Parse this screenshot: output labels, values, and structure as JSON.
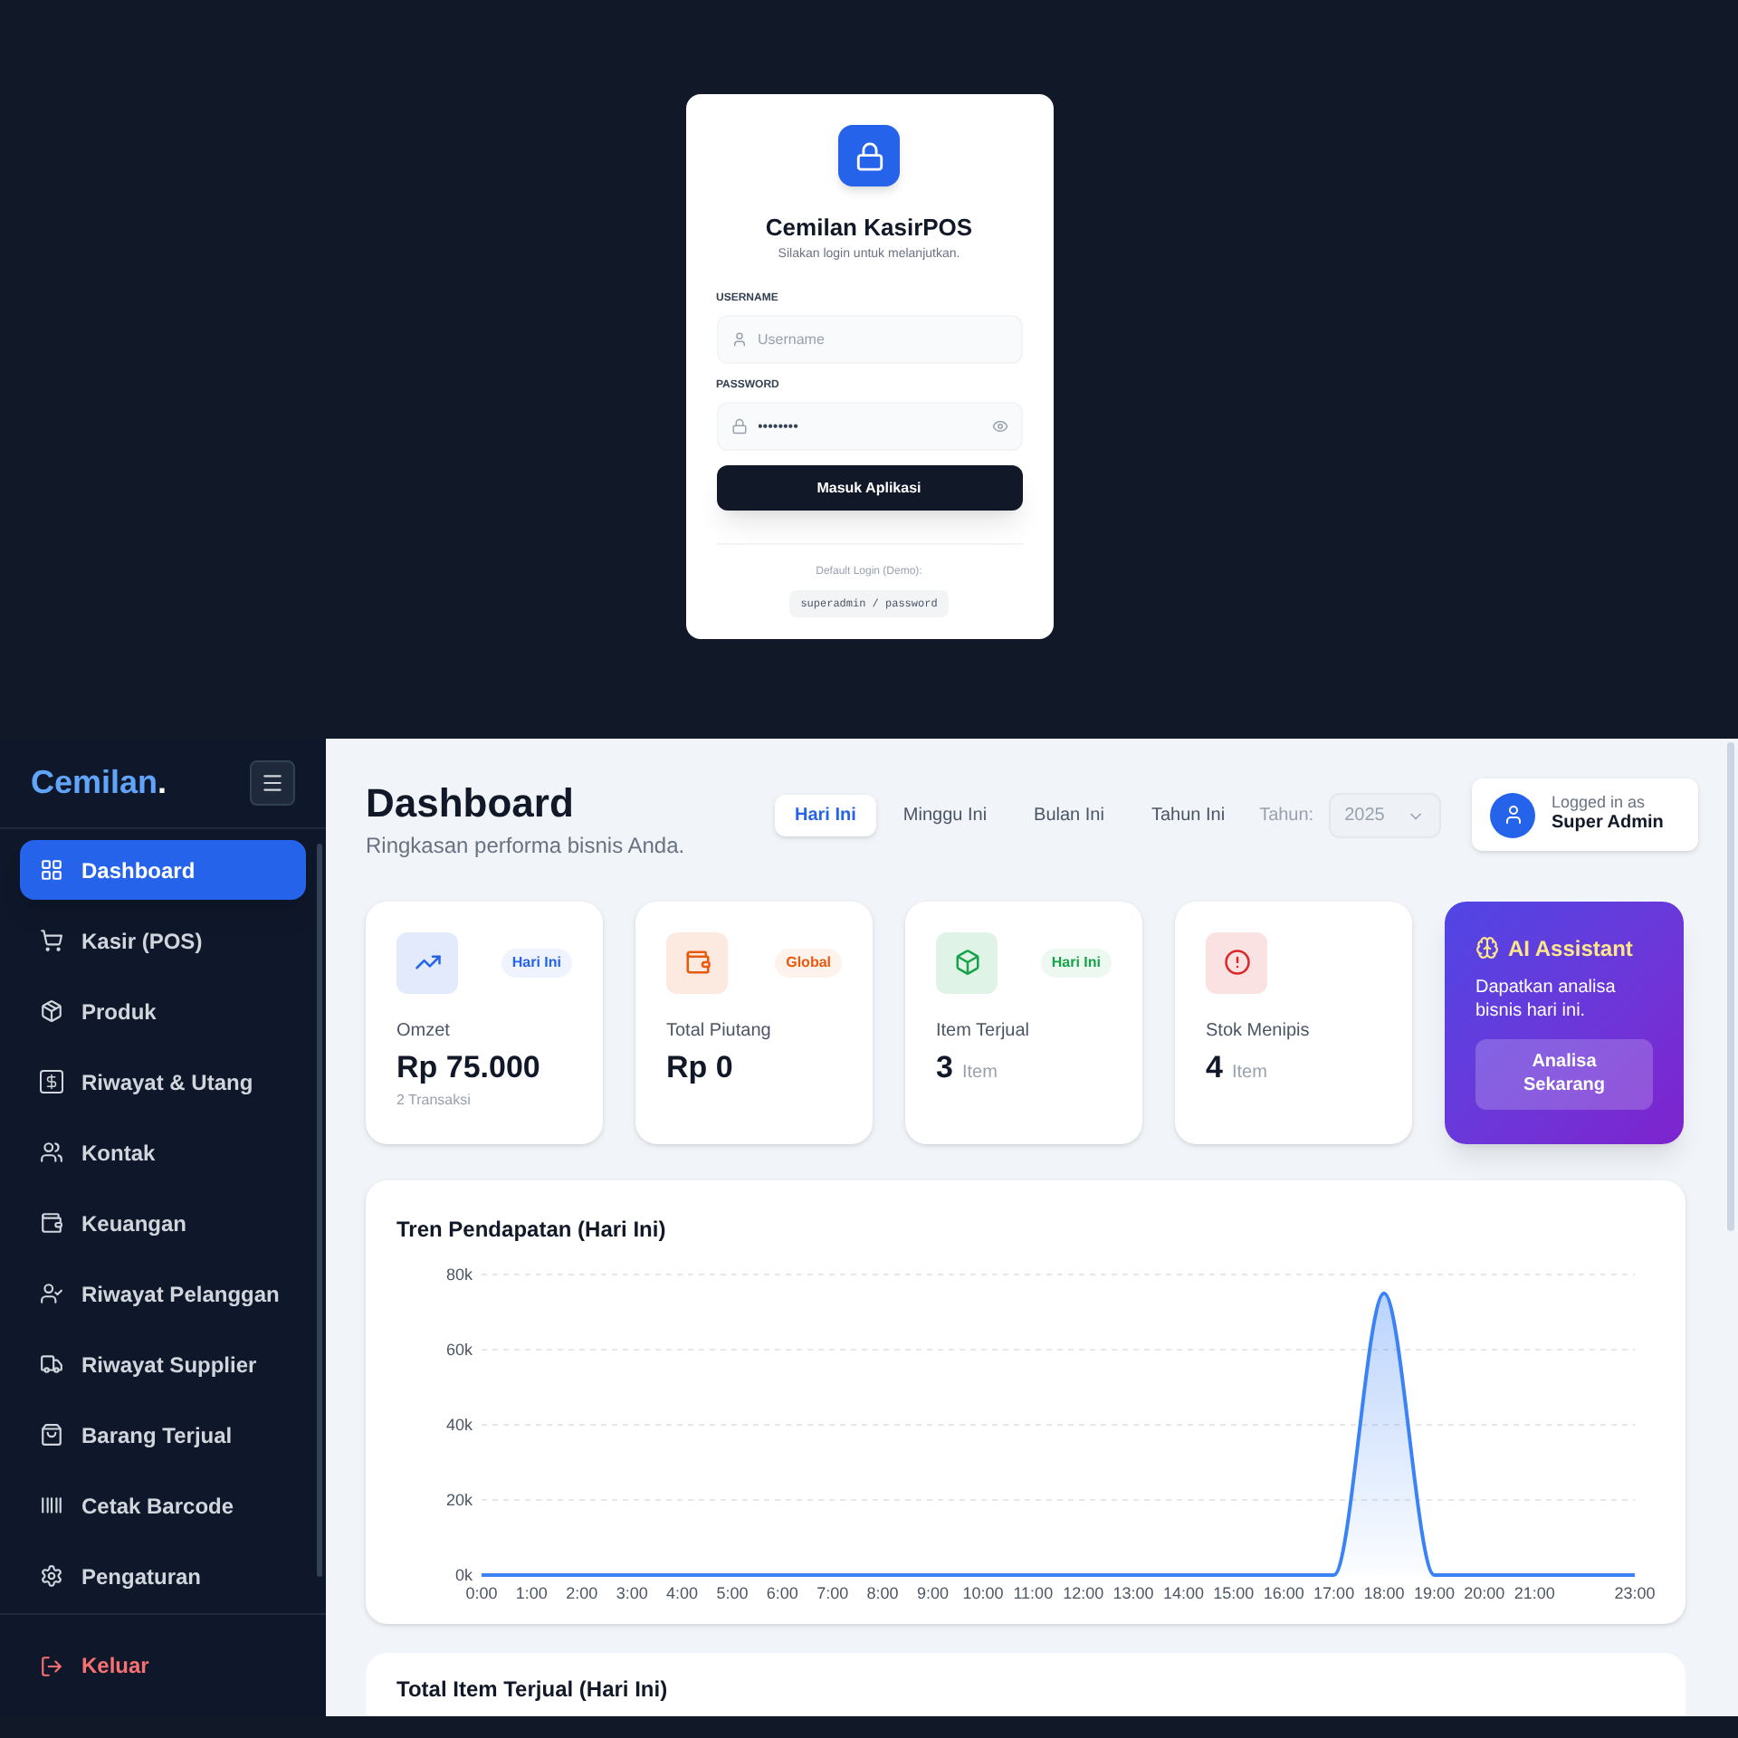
{
  "login": {
    "title": "Cemilan KasirPOS",
    "subtitle": "Silakan login untuk melanjutkan.",
    "fields": [
      {
        "label": "USERNAME",
        "placeholder": "Username",
        "kind": "text"
      },
      {
        "label": "PASSWORD",
        "value": "••••••••",
        "kind": "password"
      }
    ],
    "submit": "Masuk Aplikasi",
    "demo_label": "Default Login (Demo):",
    "demo_credentials": "superadmin / password"
  },
  "sidebar": {
    "brand": "Cemilan",
    "brand_dot": ".",
    "items": [
      {
        "label": "Dashboard",
        "selected": true
      },
      {
        "label": "Kasir (POS)",
        "selected": false
      },
      {
        "label": "Produk",
        "selected": false
      },
      {
        "label": "Riwayat & Utang",
        "selected": false
      },
      {
        "label": "Kontak",
        "selected": false
      },
      {
        "label": "Keuangan",
        "selected": false
      },
      {
        "label": "Riwayat Pelanggan",
        "selected": false
      },
      {
        "label": "Riwayat Supplier",
        "selected": false
      },
      {
        "label": "Barang Terjual",
        "selected": false
      },
      {
        "label": "Cetak Barcode",
        "selected": false
      },
      {
        "label": "Pengaturan",
        "selected": false
      }
    ],
    "logout": "Keluar"
  },
  "header": {
    "title": "Dashboard",
    "subtitle": "Ringkasan performa bisnis Anda.",
    "periods": [
      {
        "label": "Hari Ini",
        "selected": true
      },
      {
        "label": "Minggu Ini",
        "selected": false
      },
      {
        "label": "Bulan Ini",
        "selected": false
      },
      {
        "label": "Tahun Ini",
        "selected": false
      }
    ],
    "year_label": "Tahun:",
    "year": {
      "value": "2025",
      "disabled": true
    },
    "user": {
      "caption": "Logged in as",
      "name": "Super Admin"
    }
  },
  "stats": [
    {
      "badge": "Hari Ini",
      "label": "Omzet",
      "value": "Rp 75.000",
      "note": "2 Transaksi",
      "color": "#2563eb"
    },
    {
      "badge": "Global",
      "label": "Total Piutang",
      "value": "Rp 0",
      "color": "#ea580c"
    },
    {
      "badge": "Hari Ini",
      "label": "Item Terjual",
      "value": "3",
      "unit": "Item",
      "color": "#16a34a"
    },
    {
      "label": "Stok Menipis",
      "value": "4",
      "unit": "Item",
      "color": "#dc2626"
    }
  ],
  "ai": {
    "title": "AI Assistant",
    "text": "Dapatkan analisa bisnis hari ini.",
    "button": "Analisa Sekarang"
  },
  "revenue": {
    "title": "Tren Pendapatan (Hari Ini)",
    "chart_data": {
      "type": "area",
      "x": [
        0,
        1,
        2,
        3,
        4,
        5,
        6,
        7,
        8,
        9,
        10,
        11,
        12,
        13,
        14,
        15,
        16,
        17,
        18,
        19,
        20,
        21,
        22,
        23
      ],
      "grid": true,
      "xlim": [
        0,
        23
      ],
      "series": [
        {
          "color": "#3b82f6",
          "values": [
            0,
            0,
            0,
            0,
            0,
            0,
            0,
            0,
            0,
            0,
            0,
            0,
            0,
            0,
            0,
            0,
            0,
            0,
            75000,
            0,
            0,
            0,
            0,
            0
          ]
        }
      ],
      "ylim": [
        0,
        80000
      ],
      "yticks": [
        {
          "value": 0,
          "label": "0k"
        },
        {
          "value": 20000,
          "label": "20k"
        },
        {
          "value": 40000,
          "label": "40k"
        },
        {
          "value": 60000,
          "label": "60k"
        },
        {
          "value": 80000,
          "label": "80k"
        }
      ],
      "xticks": [
        {
          "value": 0,
          "label": "0:00"
        },
        {
          "value": 1,
          "label": "1:00"
        },
        {
          "value": 2,
          "label": "2:00"
        },
        {
          "value": 3,
          "label": "3:00"
        },
        {
          "value": 4,
          "label": "4:00"
        },
        {
          "value": 5,
          "label": "5:00"
        },
        {
          "value": 6,
          "label": "6:00"
        },
        {
          "value": 7,
          "label": "7:00"
        },
        {
          "value": 8,
          "label": "8:00"
        },
        {
          "value": 9,
          "label": "9:00"
        },
        {
          "value": 10,
          "label": "10:00"
        },
        {
          "value": 11,
          "label": "11:00"
        },
        {
          "value": 12,
          "label": "12:00"
        },
        {
          "value": 13,
          "label": "13:00"
        },
        {
          "value": 14,
          "label": "14:00"
        },
        {
          "value": 15,
          "label": "15:00"
        },
        {
          "value": 16,
          "label": "16:00"
        },
        {
          "value": 17,
          "label": "17:00"
        },
        {
          "value": 18,
          "label": "18:00"
        },
        {
          "value": 19,
          "label": "19:00"
        },
        {
          "value": 20,
          "label": "20:00"
        },
        {
          "value": 21,
          "label": "21:00"
        },
        {
          "value": 23,
          "label": "23:00"
        }
      ]
    }
  },
  "items_sold": {
    "title": "Total Item Terjual (Hari Ini)"
  }
}
